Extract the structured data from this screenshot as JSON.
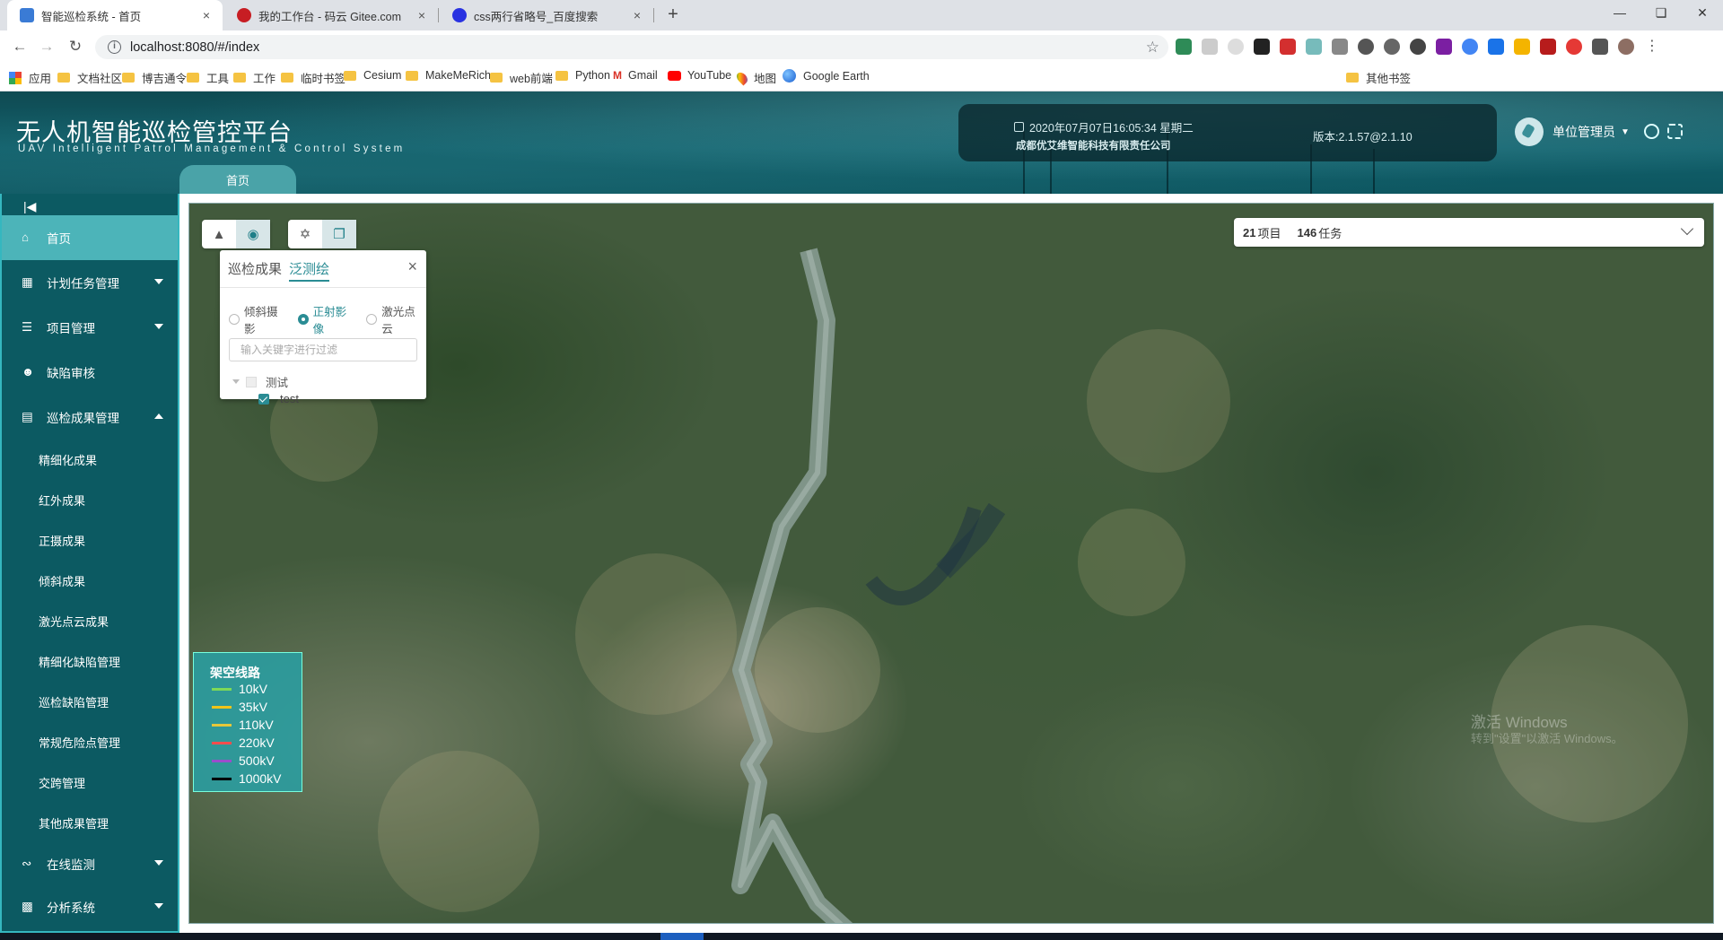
{
  "browser": {
    "tabs": [
      {
        "title": "智能巡检系统 - 首页",
        "close": "×"
      },
      {
        "title": "我的工作台 - 码云 Gitee.com",
        "close": "×"
      },
      {
        "title": "css两行省略号_百度搜索",
        "close": "×"
      }
    ],
    "new_tab": "+",
    "url": "localhost:8080/#/index",
    "bookmarks": [
      "应用",
      "文档社区",
      "博吉通令",
      "工具",
      "工作",
      "临时书签",
      "Cesium",
      "MakeMeRich",
      "web前端",
      "Python",
      "Gmail",
      "YouTube",
      "地图",
      "Google Earth"
    ],
    "other_bookmarks": "其他书签"
  },
  "header": {
    "title": "无人机智能巡检管控平台",
    "subtitle": "UAV Intelligent Patrol Management & Control System",
    "datetime": "2020年07月07日16:05:34 星期二",
    "company": "成都优艾维智能科技有限责任公司",
    "version": "版本:2.1.57@2.1.10",
    "user": "单位管理员",
    "home_tab": "首页"
  },
  "sidebar": {
    "items": [
      {
        "label": "首页",
        "icon": "home-icon",
        "active": true
      },
      {
        "label": "计划任务管理",
        "icon": "calendar-icon",
        "expandable": true
      },
      {
        "label": "项目管理",
        "icon": "database-icon",
        "expandable": true
      },
      {
        "label": "缺陷审核",
        "icon": "user-icon"
      },
      {
        "label": "巡检成果管理",
        "icon": "folder-icon",
        "expanded": true
      }
    ],
    "subitems": [
      "精细化成果",
      "红外成果",
      "正摄成果",
      "倾斜成果",
      "激光点云成果",
      "精细化缺陷管理",
      "巡检缺陷管理",
      "常规危险点管理",
      "交跨管理",
      "其他成果管理"
    ],
    "bottom_items": [
      {
        "label": "在线监测",
        "icon": "satellite-icon"
      },
      {
        "label": "分析系统",
        "icon": "chart-icon"
      }
    ]
  },
  "map": {
    "stats": {
      "projects": "21",
      "projects_label": "项目",
      "tasks": "146",
      "tasks_label": "任务"
    },
    "panel": {
      "tabs": [
        "巡检成果",
        "泛测绘"
      ],
      "active_tab": 1,
      "radios": [
        "倾斜摄影",
        "正射影像",
        "激光点云"
      ],
      "selected_radio": 1,
      "filter_placeholder": "输入关键字进行过滤",
      "tree_parent": "测试",
      "tree_child": "test"
    },
    "legend": {
      "title": "架空线路",
      "items": [
        {
          "label": "10kV",
          "color": "#7ed957"
        },
        {
          "label": "35kV",
          "color": "#f0c419"
        },
        {
          "label": "110kV",
          "color": "#e6c73a"
        },
        {
          "label": "220kV",
          "color": "#ff4d4d"
        },
        {
          "label": "500kV",
          "color": "#9b4dcc"
        },
        {
          "label": "1000kV",
          "color": "#000000"
        }
      ]
    },
    "watermark": "激活 Windows",
    "watermark_sub": "转到\"设置\"以激活 Windows。"
  }
}
